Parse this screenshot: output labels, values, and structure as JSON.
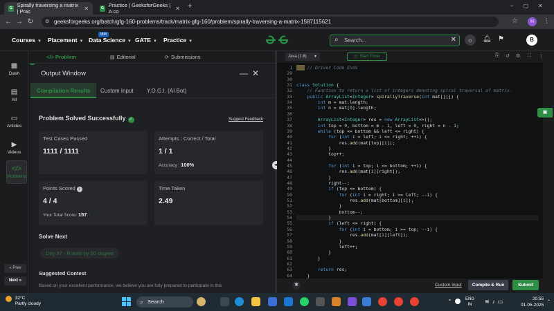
{
  "browser": {
    "tabs": [
      {
        "label": "Spirally traversing a matrix | Prac"
      },
      {
        "label": "Practice | GeeksforGeeks | A co"
      }
    ],
    "url": "geeksforgeeks.org/batch/gfg-160-problems/track/matrix-gfg-160/problem/spirally-traversing-a-matrix-1587115621",
    "profile_initial": "H"
  },
  "header": {
    "nav": [
      "Courses",
      "Placement",
      "Data Science",
      "GATE",
      "Practice"
    ],
    "ibm_badge": "IBM",
    "logo": "GG",
    "search_placeholder": "Search...",
    "avatar_initial": "B"
  },
  "sidebar": {
    "items": [
      {
        "label": "Dash",
        "icon": "dashboard-icon"
      },
      {
        "label": "All",
        "icon": "grid-icon"
      },
      {
        "label": "Articles",
        "icon": "article-icon"
      },
      {
        "label": "Videos",
        "icon": "video-icon"
      },
      {
        "label": "Problems",
        "icon": "code-icon"
      }
    ],
    "prev": "« Prev",
    "next": "Next »"
  },
  "problem_tabs": [
    "</> Problem",
    "Editorial",
    "Submissions"
  ],
  "output": {
    "title": "Output Window",
    "tabs": [
      "Compilation Results",
      "Custom Input",
      "Y.O.G.I. (AI Bot)"
    ],
    "status": "Problem Solved Successfully",
    "suggest_feedback": "Suggest Feedback",
    "test_cases_label": "Test Cases Passed",
    "test_cases_value": "1111 / 1111",
    "attempts_label": "Attempts : Correct / Total",
    "attempts_value": "1 / 1",
    "accuracy_label": "Accuracy :",
    "accuracy_value": "100%",
    "points_label": "Points Scored",
    "points_value": "4 / 4",
    "total_score_label": "Your Total Score:",
    "total_score_value": "157",
    "time_label": "Time Taken",
    "time_value": "2.49",
    "solve_next_heading": "Solve Next",
    "solve_next_item": "Day 37 - Rotate by 90 degree",
    "suggested_heading": "Suggested Contest",
    "suggested_text": "Based on your excellent performance, we believe you are fully prepared to participate in this"
  },
  "editor": {
    "language": "Java (1.8)",
    "timer_label": "Start Timer",
    "start_line": 1,
    "lines": [
      {
        "n": "1",
        "code": ""
      },
      {
        "n": "29",
        "code": ""
      },
      {
        "n": "30",
        "code": ""
      },
      {
        "n": "31",
        "code": "class Solution {"
      },
      {
        "n": "32",
        "code": "    // Function to return a list of integers denoting spiral traversal of matrix."
      },
      {
        "n": "33",
        "code": "    public ArrayList<Integer> spirallyTraverse(int mat[][]) {"
      },
      {
        "n": "34",
        "code": "        int m = mat.length;"
      },
      {
        "n": "35",
        "code": "        int n = mat[0].length;"
      },
      {
        "n": "36",
        "code": ""
      },
      {
        "n": "37",
        "code": "        ArrayList<Integer> res = new ArrayList<>();"
      },
      {
        "n": "38",
        "code": "        int top = 0, bottom = m - 1, left = 0, right = n - 1;"
      },
      {
        "n": "39",
        "code": "        while (top <= bottom && left <= right) {"
      },
      {
        "n": "40",
        "code": "            for (int i = left; i <= right; ++i) {"
      },
      {
        "n": "41",
        "code": "                res.add(mat[top][i]);"
      },
      {
        "n": "42",
        "code": "            }"
      },
      {
        "n": "43",
        "code": "            top++;"
      },
      {
        "n": "44",
        "code": ""
      },
      {
        "n": "45",
        "code": "            for (int i = top; i <= bottom; ++i) {"
      },
      {
        "n": "46",
        "code": "                res.add(mat[i][right]);"
      },
      {
        "n": "47",
        "code": "            }"
      },
      {
        "n": "48",
        "code": "            right--;"
      },
      {
        "n": "49",
        "code": "            if (top <= bottom) {"
      },
      {
        "n": "50",
        "code": "                for (int i = right; i >= left; --i) {"
      },
      {
        "n": "51",
        "code": "                    res.add(mat[bottom][i]);"
      },
      {
        "n": "52",
        "code": "                }"
      },
      {
        "n": "53",
        "code": "                bottom--;"
      },
      {
        "n": "54",
        "code": "            }"
      },
      {
        "n": "55",
        "code": "            if (left <= right) {"
      },
      {
        "n": "56",
        "code": "                for (int i = bottom; i >= top; --i) {"
      },
      {
        "n": "57",
        "code": "                    res.add(mat[i][left]);"
      },
      {
        "n": "58",
        "code": "                }"
      },
      {
        "n": "59",
        "code": "                left++;"
      },
      {
        "n": "60",
        "code": "            }"
      },
      {
        "n": "61",
        "code": "        }"
      },
      {
        "n": "62",
        "code": ""
      },
      {
        "n": "63",
        "code": "        return res;"
      },
      {
        "n": "64",
        "code": "    }"
      }
    ],
    "folded_comment": "// Driver Code Ends",
    "custom_input": "Custom Input",
    "compile_run": "Compile & Run",
    "submit": "Submit"
  },
  "taskbar": {
    "temperature": "32°C",
    "weather": "Partly cloudy",
    "search": "Search",
    "lang": "ENG",
    "region": "IN",
    "time": "20:55",
    "date": "01-05-2025"
  },
  "colors": {
    "brand_green": "#2f8d46",
    "editor_bg": "#101112",
    "panel_bg": "#1f2023"
  }
}
